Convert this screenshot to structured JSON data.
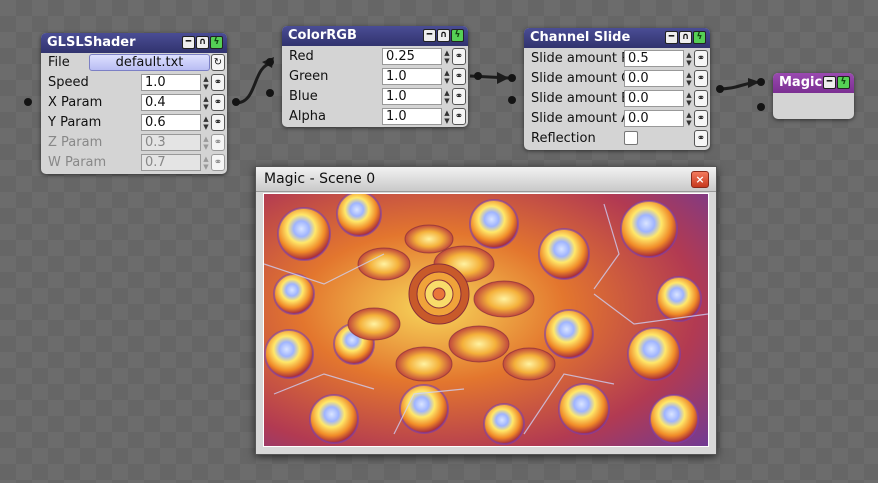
{
  "nodes": {
    "glsl": {
      "title": "GLSLShader",
      "file_label": "File",
      "file_value": "default.txt",
      "params": [
        {
          "label": "Speed",
          "value": "1.0",
          "enabled": true
        },
        {
          "label": "X Param",
          "value": "0.4",
          "enabled": true
        },
        {
          "label": "Y Param",
          "value": "0.6",
          "enabled": true
        },
        {
          "label": "Z Param",
          "value": "0.3",
          "enabled": false
        },
        {
          "label": "W Param",
          "value": "0.7",
          "enabled": false
        }
      ]
    },
    "color": {
      "title": "ColorRGB",
      "params": [
        {
          "label": "Red",
          "value": "0.25"
        },
        {
          "label": "Green",
          "value": "1.0"
        },
        {
          "label": "Blue",
          "value": "1.0"
        },
        {
          "label": "Alpha",
          "value": "1.0"
        }
      ]
    },
    "channel": {
      "title": "Channel Slide",
      "params": [
        {
          "label": "Slide amount R",
          "value": "0.5"
        },
        {
          "label": "Slide amount G",
          "value": "0.0"
        },
        {
          "label": "Slide amount B",
          "value": "0.0"
        },
        {
          "label": "Slide amount A",
          "value": "0.0"
        }
      ],
      "reflection_label": "Reflection",
      "reflection_checked": false
    },
    "magic": {
      "title": "Magic"
    }
  },
  "preview_window": {
    "title": "Magic - Scene 0",
    "close_glyph": "×"
  },
  "icons": {
    "minimize": "minus-icon",
    "bypass": "arch-icon",
    "enable": "lightning-icon",
    "link": "link-icon",
    "reload": "reload-icon",
    "spinner": "spinner-arrows-icon"
  },
  "colors": {
    "node_header": "#3d3f82",
    "magic_header": "#8a3aa2",
    "canvas_bg": "#6c6c6c",
    "enable_button": "#55d055"
  }
}
